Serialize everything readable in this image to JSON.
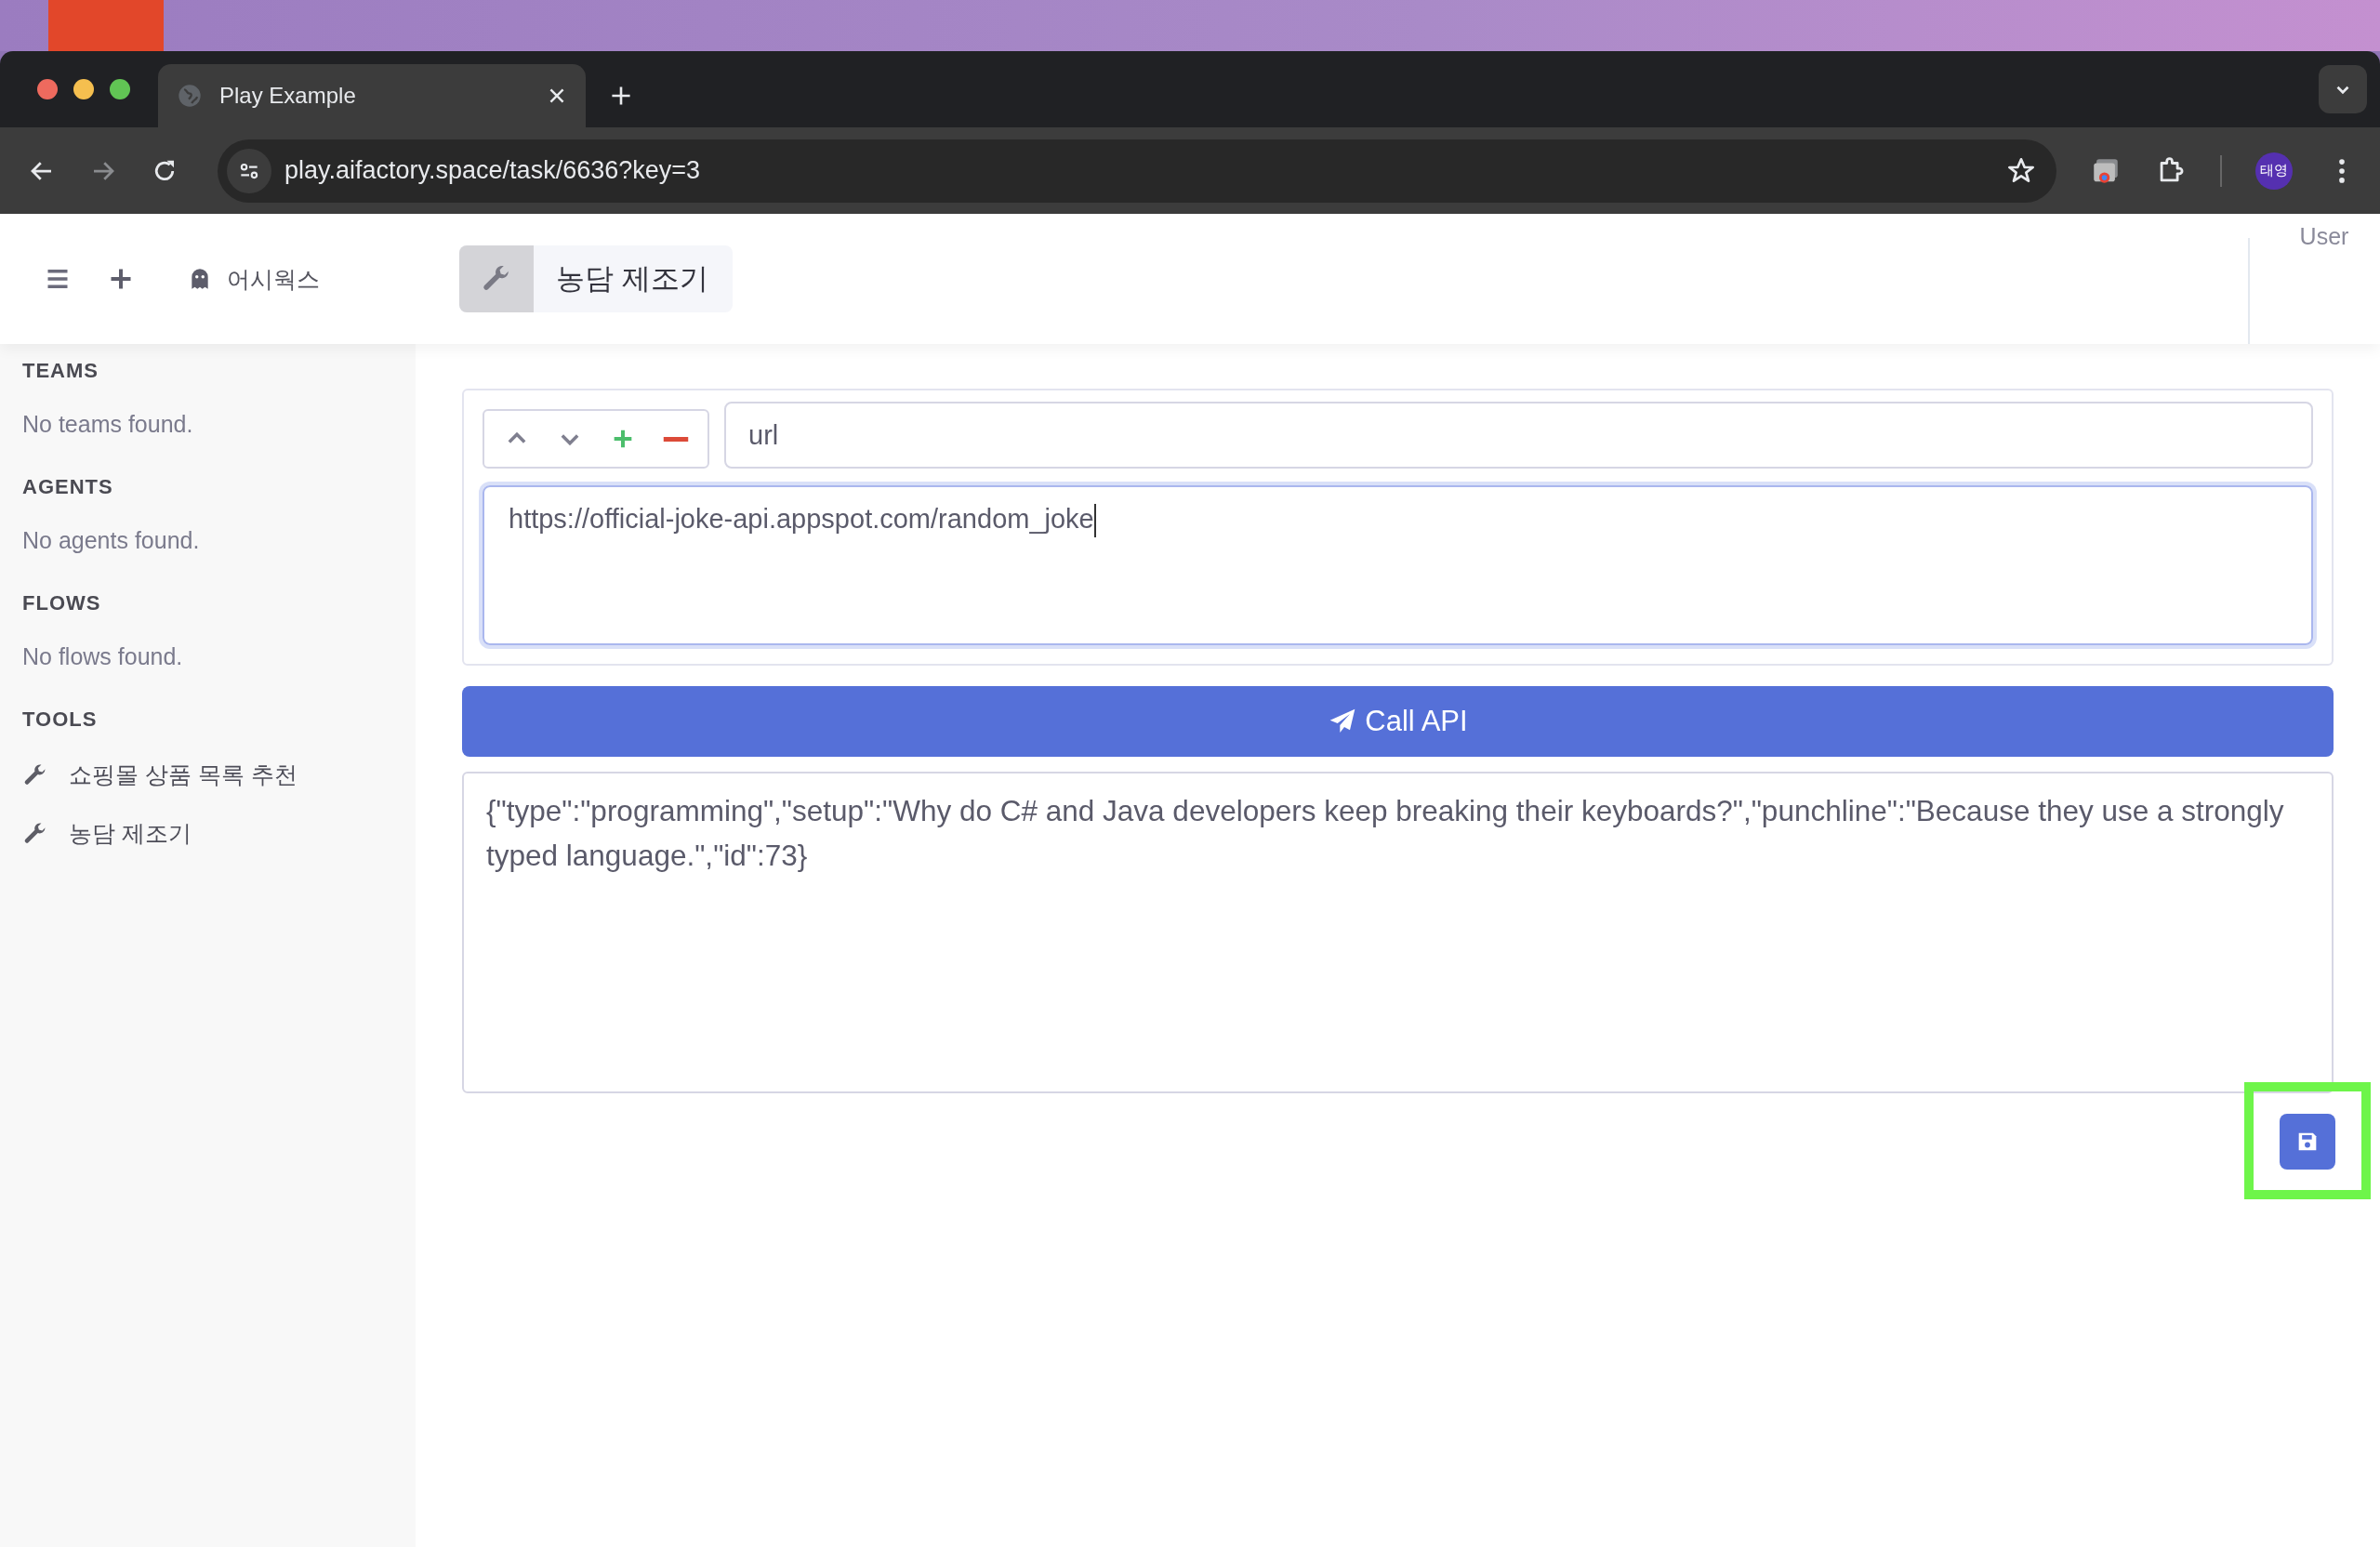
{
  "browser": {
    "tab_title": "Play Example",
    "url": "play.aifactory.space/task/6636?key=3",
    "profile": "태영"
  },
  "header": {
    "workspace": "어시웍스",
    "tool_title": "농담 제조기",
    "user": "User"
  },
  "sidebar": {
    "sections": [
      {
        "title": "TEAMS",
        "empty_text": "No teams found."
      },
      {
        "title": "AGENTS",
        "empty_text": "No agents found."
      },
      {
        "title": "FLOWS",
        "empty_text": "No flows found."
      },
      {
        "title": "TOOLS",
        "items": [
          {
            "label": "쇼핑몰 상품 목록 추천"
          },
          {
            "label": "농담 제조기"
          }
        ]
      }
    ]
  },
  "editor": {
    "param_name": "url",
    "param_value": "https://official-joke-api.appspot.com/random_joke",
    "call_button": "Call API",
    "response": "{\"type\":\"programming\",\"setup\":\"Why do C# and Java developers keep breaking their keyboards?\",\"punchline\":\"Because they use a strongly typed language.\",\"id\":73}"
  }
}
